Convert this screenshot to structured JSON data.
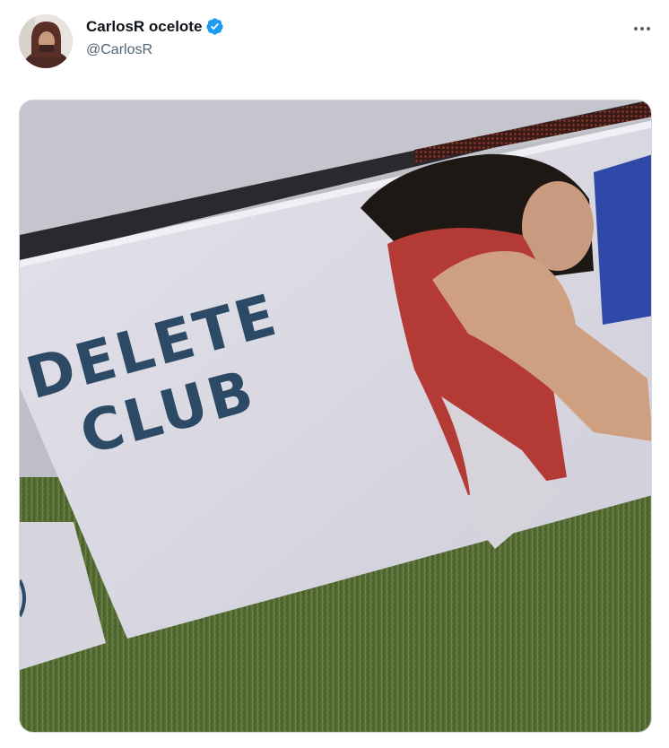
{
  "tweet": {
    "display_name": "CarlosR ocelote",
    "handle": "@CarlosR",
    "verified": true,
    "more_icon": "more-horizontal-icon",
    "avatar_icon": "user-avatar",
    "colors": {
      "verified_blue": "#1d9bf0",
      "name_text": "#0f1419",
      "handle_text": "#536471"
    },
    "media": {
      "line1": "DELETE",
      "line2": "CLUB"
    }
  }
}
